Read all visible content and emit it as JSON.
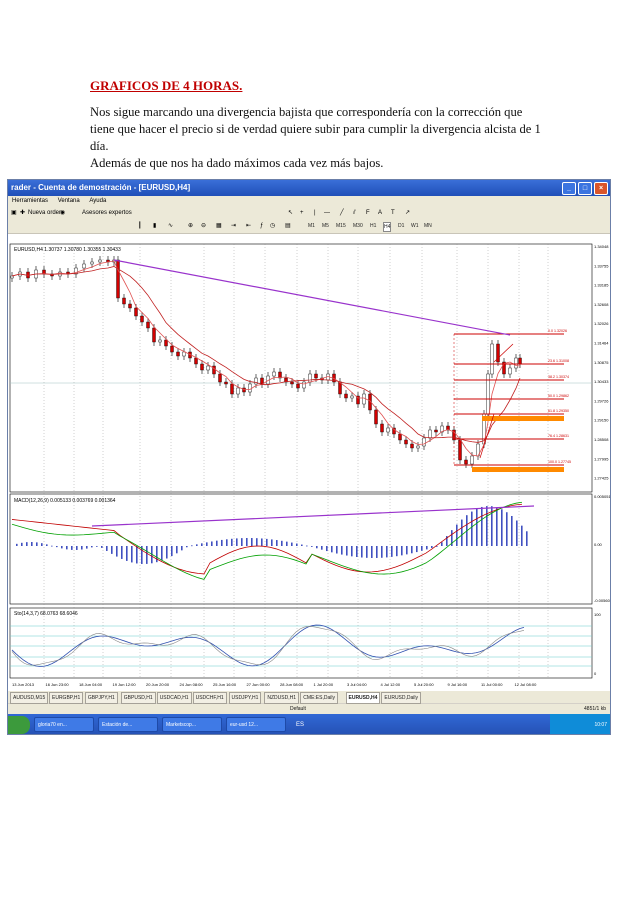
{
  "document": {
    "heading": "GRAFICOS DE 4 HORAS.",
    "lines": [
      "Nos sigue marcando una divergencia bajista que correspondería con la corrección que",
      "tiene que hacer el precio si de verdad quiere subir para cumplir la divergencia alcista de 1",
      "día.",
      "Además de que nos ha dado máximos cada vez más bajos."
    ]
  },
  "window": {
    "title": "rader - Cuenta de demostración - [EURUSD,H4]",
    "menu": [
      "Herramientas",
      "Ventana",
      "Ayuda"
    ],
    "toolbar": {
      "new_order": "Nueva orden",
      "experts": "Asesores expertos"
    },
    "timeframes": [
      "M1",
      "M5",
      "M15",
      "M30",
      "H1",
      "H4",
      "D1",
      "W1",
      "MN"
    ]
  },
  "chart": {
    "main_label": "EURUSD,H4  1.30737 1.30780 1.30355 1.30433",
    "price_axis": [
      "1.34048",
      "1.33755",
      "1.33185",
      "1.32608",
      "1.32026",
      "1.31464",
      "1.30875",
      "1.30433",
      "1.29726",
      "1.29150",
      "1.28508",
      "1.27995",
      "1.27425"
    ],
    "fib_labels": [
      "0.0  1.32026",
      "23.6  1.31008",
      "38.2  1.30374",
      "50.0  1.29862",
      "61.8  1.29350",
      "76.4  1.28631",
      "100.0  1.27745"
    ],
    "macd_label": "MACD(12,26,9) 0.005133 0.003769 0.001364",
    "macd_axis": [
      "0.005051",
      "0.00",
      "-0.005602"
    ],
    "stoch_label": "Sto(14,3,7) 68.0763 68.6046",
    "stoch_axis": [
      "100",
      "0"
    ],
    "time_axis": [
      "13 Jun 2013",
      "16 Jun 23:00",
      "18 Jun 04:00",
      "19 Jun 12:00",
      "20 Jun 20:00",
      "24 Jun 08:00",
      "25 Jun 16:00",
      "27 Jun 00:00",
      "28 Jun 08:00",
      "1 Jul 20:00",
      "3 Jul 04:00",
      "4 Jul 12:00",
      "5 Jul 20:00",
      "9 Jul 16:00",
      "11 Jul 00:00",
      "12 Jul 08:00"
    ],
    "colors": {
      "candle": "#d40000",
      "bearish_trend": "#9933cc",
      "fib": "#cc0000",
      "fib_band": "#ff8a00",
      "ma": "#e05050",
      "macd_hist": "#4050c0",
      "green": "#00a000"
    }
  },
  "tabs": [
    "AUDUSD,M15",
    "EURGBP,H1",
    "GBPJPY,H1",
    "GBPUSD,H1",
    "USDCAD,H1",
    "USDCHF,H1",
    "USDJPY,H1",
    "NZDUSD,H1",
    "CME:ES,Daily",
    "EURUSD,H4",
    "EURUSD,Daily"
  ],
  "active_tab": "EURUSD,H4",
  "status": {
    "profile": "Default",
    "traffic": "4851/1 kb"
  },
  "taskbar": {
    "tasks": [
      "gloria70 en...",
      "Estación de...",
      "Marketscop...",
      "eur-usd 12..."
    ],
    "lang": "ES",
    "clock": "10:07"
  }
}
